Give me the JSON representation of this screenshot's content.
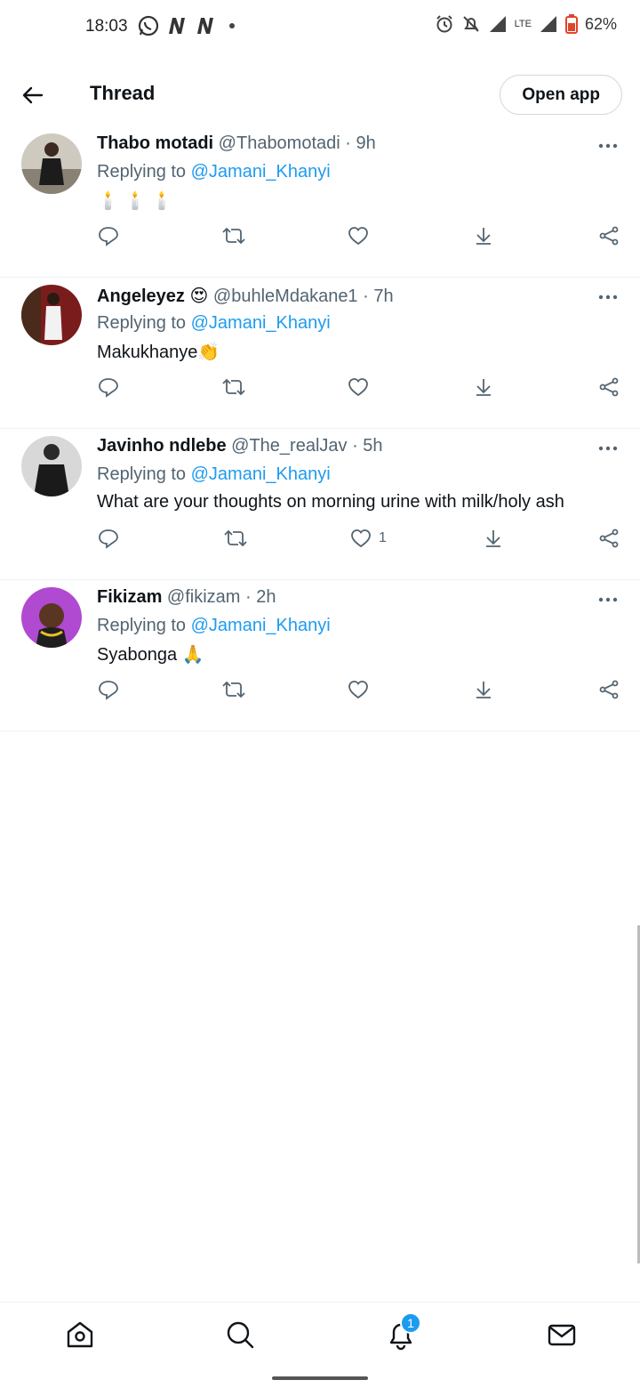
{
  "status_bar": {
    "time": "18:03",
    "battery": "62%",
    "network": "LTE"
  },
  "header": {
    "title": "Thread",
    "open_app_label": "Open app"
  },
  "tweets": [
    {
      "name": "Thabo motadi",
      "handle": "@Thabomotadi",
      "time": "· 9h",
      "replying_prefix": "Replying to",
      "replying_to": "@Jamani_Khanyi",
      "text": "🕯️ 🕯️ 🕯️",
      "likes": ""
    },
    {
      "name": "Angeleyez",
      "name_emoji": "😍",
      "handle": "@buhleMdakane1",
      "time": "· 7h",
      "replying_prefix": "Replying to",
      "replying_to": "@Jamani_Khanyi",
      "text": "Makukhanye👏",
      "likes": ""
    },
    {
      "name": "Javinho ndlebe",
      "handle": "@The_realJav",
      "time": "· 5h",
      "replying_prefix": "Replying to",
      "replying_to": "@Jamani_Khanyi",
      "text": "What are your thoughts on morning urine with milk/holy ash",
      "likes": "1"
    },
    {
      "name": "Fikizam",
      "handle": "@fikizam",
      "time": "· 2h",
      "replying_prefix": "Replying to",
      "replying_to": "@Jamani_Khanyi",
      "text": "Syabonga 🙏",
      "likes": ""
    }
  ],
  "bottom_nav": {
    "notifications_badge": "1",
    "items": [
      "home-icon",
      "search-icon",
      "notifications-icon",
      "messages-icon"
    ]
  },
  "colors": {
    "accent": "#1d9bf0",
    "text": "#0f1419",
    "secondary": "#536471",
    "divider": "#eff3f4"
  }
}
